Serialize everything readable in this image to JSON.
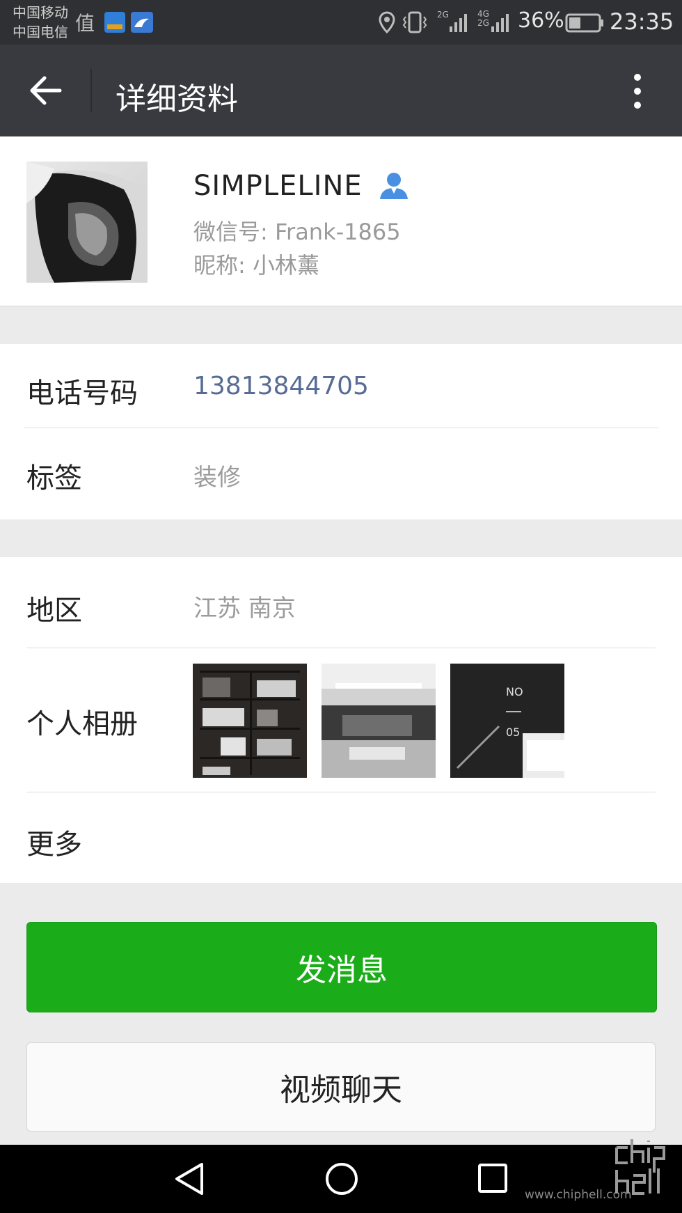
{
  "status_bar": {
    "carrier_1": "中国移动",
    "carrier_2": "中国电信",
    "app_glyph": "值",
    "net_2g": "2G",
    "net_4g": "4G",
    "net_2g_b": "2G",
    "battery": "36%",
    "time": "23:35"
  },
  "header": {
    "title": "详细资料"
  },
  "profile": {
    "name": "SIMPLELINE",
    "wechat_id": "微信号: Frank-1865",
    "nickname": "昵称: 小林薰"
  },
  "info": {
    "phone_label": "电话号码",
    "phone_value": "13813844705",
    "tag_label": "标签",
    "tag_value": "装修"
  },
  "details": {
    "region_label": "地区",
    "region_value": "江苏  南京",
    "album_label": "个人相册",
    "album_photo3_text_top": "NO",
    "album_photo3_text_bottom": "05",
    "more_label": "更多"
  },
  "actions": {
    "send_message": "发消息",
    "video_chat": "视频聊天"
  },
  "watermark": {
    "url": "www.chiphell.com"
  },
  "colors": {
    "accent_green": "#1aad19",
    "phone_link": "#576b95",
    "title_bar": "#393a3f"
  }
}
